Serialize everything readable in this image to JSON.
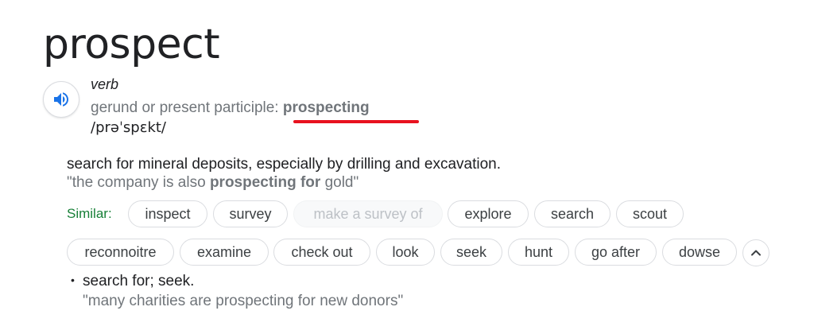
{
  "headword": "prospect",
  "part_of_speech": "verb",
  "inflection": {
    "label": "gerund or present participle: ",
    "form": "prospecting"
  },
  "phonetic": "/prəˈspɛkt/",
  "sense1": {
    "definition": "search for mineral deposits, especially by drilling and excavation.",
    "example": {
      "open_quote": "\"the company is also ",
      "highlight": "prospecting for",
      "rest": " gold\""
    }
  },
  "similar": {
    "label": "Similar:",
    "row1": [
      "inspect",
      "survey",
      "make a survey of",
      "explore",
      "search",
      "scout"
    ],
    "row2": [
      "reconnoitre",
      "examine",
      "check out",
      "look",
      "seek",
      "hunt",
      "go after",
      "dowse"
    ]
  },
  "sense2": {
    "bullet": "•",
    "definition": "search for; seek.",
    "example": "\"many charities are prospecting for new donors\""
  },
  "icons": {
    "speaker": "speaker-icon",
    "collapse": "chevron-up-icon"
  },
  "colors": {
    "accent_blue": "#1a73e8",
    "similar_green": "#188038",
    "annotation_red": "#e8121f",
    "muted_gray": "#70757a"
  }
}
